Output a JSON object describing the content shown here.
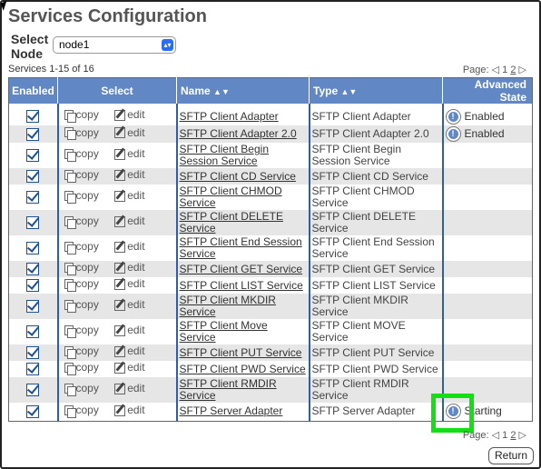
{
  "page": {
    "title": "Services Configuration",
    "node_label": "Select Node",
    "node_value": "node1",
    "services_count": "Services 1-15 of 16",
    "pager_label": "Page:",
    "pager_page1": "1",
    "pager_page2": "2",
    "return_label": "Return"
  },
  "table": {
    "headers": {
      "enabled": "Enabled",
      "select": "Select",
      "name": "Name",
      "type": "Type",
      "advanced": "Advanced State"
    },
    "copy_label": "copy",
    "edit_label": "edit",
    "rows": [
      {
        "name": "SFTP Client Adapter",
        "type": "SFTP Client Adapter",
        "state": "Enabled",
        "enabled": true
      },
      {
        "name": "SFTP Client Adapter 2.0",
        "type": "SFTP Client Adapter 2.0",
        "state": "Enabled",
        "enabled": true
      },
      {
        "name": "SFTP Client Begin Session Service",
        "type": "SFTP Client Begin Session Service",
        "state": "",
        "enabled": true
      },
      {
        "name": "SFTP Client CD Service",
        "type": "SFTP Client CD Service",
        "state": "",
        "enabled": true
      },
      {
        "name": "SFTP Client CHMOD Service",
        "type": "SFTP Client CHMOD Service",
        "state": "",
        "enabled": true
      },
      {
        "name": "SFTP Client DELETE Service",
        "type": "SFTP Client DELETE Service",
        "state": "",
        "enabled": true
      },
      {
        "name": "SFTP Client End Session Service",
        "type": "SFTP Client End Session Service",
        "state": "",
        "enabled": true
      },
      {
        "name": "SFTP Client GET Service",
        "type": "SFTP Client GET Service",
        "state": "",
        "enabled": true
      },
      {
        "name": "SFTP Client LIST Service",
        "type": "SFTP Client LIST Service",
        "state": "",
        "enabled": true
      },
      {
        "name": "SFTP Client MKDIR Service",
        "type": "SFTP Client MKDIR Service",
        "state": "",
        "enabled": true
      },
      {
        "name": "SFTP Client Move Service",
        "type": "SFTP Client MOVE Service",
        "state": "",
        "enabled": true
      },
      {
        "name": "SFTP Client PUT Service",
        "type": "SFTP Client PUT Service",
        "state": "",
        "enabled": true
      },
      {
        "name": "SFTP Client PWD Service",
        "type": "SFTP Client PWD Service",
        "state": "",
        "enabled": true
      },
      {
        "name": "SFTP Client RMDIR Service",
        "type": "SFTP Client RMDIR Service",
        "state": "",
        "enabled": true
      },
      {
        "name": "SFTP Server Adapter",
        "type": "SFTP Server Adapter",
        "state": "Starting",
        "enabled": true
      }
    ]
  }
}
